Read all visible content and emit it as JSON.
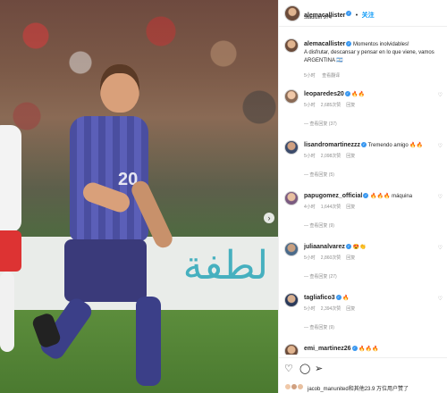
{
  "post": {
    "author": "alemacallister",
    "follow_label": "关注",
    "location": "Stadium 974",
    "caption_line1": "Momentos inolvidables!",
    "caption_line2": "A disfrutar, descansar y pensar en lo que viene, vamos ARGENTINA",
    "caption_suffix": "🇦🇷",
    "caption_time": "5小时",
    "caption_see_translation": "查看翻译"
  },
  "photo": {
    "jersey_number": "20",
    "board_text": "لطفة"
  },
  "comments": [
    {
      "user": "leoparedes20",
      "text": "🔥🔥",
      "time": "5小时",
      "likes": "2,685次赞",
      "reply": "回复",
      "replies": "查看回复 (37)"
    },
    {
      "user": "lisandromartinezzz",
      "text": "Tremendo amigo 🔥🔥",
      "time": "5小时",
      "likes": "2,098次赞",
      "reply": "回复",
      "replies": "查看回复 (5)"
    },
    {
      "user": "papugomez_official",
      "text": "🔥🔥🔥 máquina",
      "time": "4小时",
      "likes": "1,644次赞",
      "reply": "回复",
      "replies": "查看回复 (9)"
    },
    {
      "user": "juliaanalvarez",
      "text": "😍👏",
      "time": "5小时",
      "likes": "2,860次赞",
      "reply": "回复",
      "replies": "查看回复 (27)"
    },
    {
      "user": "tagliafico3",
      "text": "🔥",
      "time": "5小时",
      "likes": "2,394次赞",
      "reply": "回复",
      "replies": "查看回复 (9)"
    },
    {
      "user": "emi_martinez26",
      "text": "🔥🔥🔥",
      "time": "",
      "likes": "",
      "reply": "",
      "replies": ""
    }
  ],
  "likes_line": "jacob_manunited和其他23.9 万位用户赞了"
}
